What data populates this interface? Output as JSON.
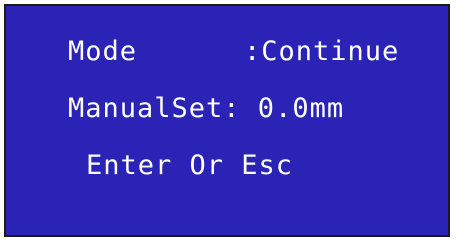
{
  "screen": {
    "mode_label": "Mode",
    "mode_value": ":Continue",
    "manual_label": "ManualSet: 0.0mm",
    "prompt": "Enter Or Esc"
  },
  "colors": {
    "screen_background": "#2b23b6",
    "text": "#ffffff",
    "border": "#1a1a1a"
  }
}
